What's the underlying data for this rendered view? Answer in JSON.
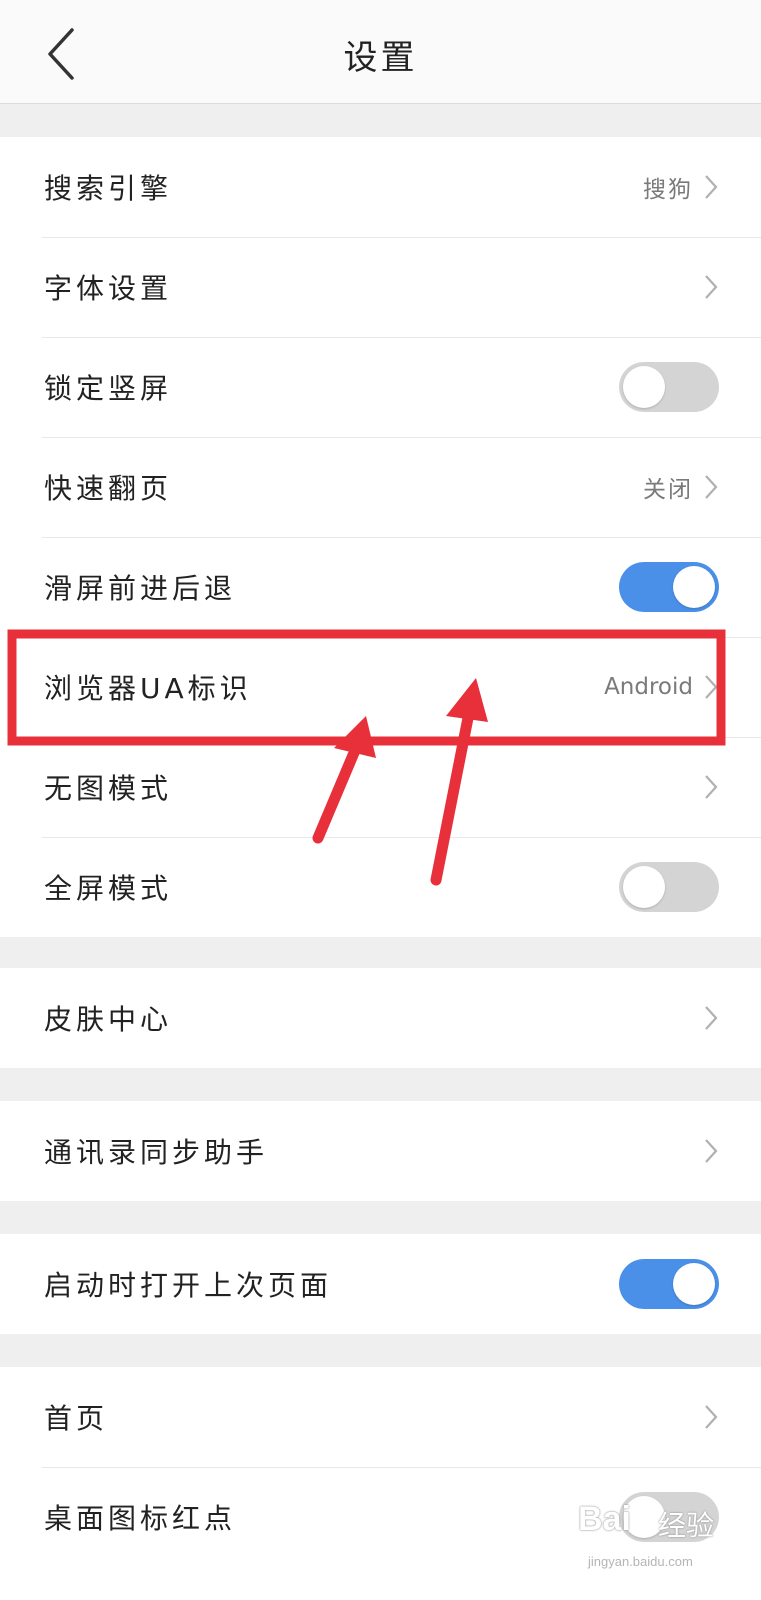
{
  "header": {
    "title": "设置"
  },
  "groups": [
    {
      "rows": [
        {
          "label": "搜索引擎",
          "value": "搜狗"
        },
        {
          "label": "字体设置"
        },
        {
          "label": "锁定竖屏",
          "toggle": false
        },
        {
          "label": "快速翻页",
          "value": "关闭"
        },
        {
          "label": "滑屏前进后退",
          "toggle": true
        },
        {
          "label": "浏览器UA标识",
          "value": "Android"
        },
        {
          "label": "无图模式"
        },
        {
          "label": "全屏模式",
          "toggle": false
        }
      ]
    },
    {
      "rows": [
        {
          "label": "皮肤中心"
        }
      ]
    },
    {
      "rows": [
        {
          "label": "通讯录同步助手"
        }
      ]
    },
    {
      "rows": [
        {
          "label": "启动时打开上次页面",
          "toggle": true
        }
      ]
    },
    {
      "rows": [
        {
          "label": "首页"
        },
        {
          "label": "桌面图标红点",
          "toggle": false
        }
      ]
    }
  ],
  "colors": {
    "toggle_on": "#4a90e8",
    "toggle_off": "#d4d4d4",
    "annotation": "#e8303a"
  },
  "watermark": {
    "logo": "Bai",
    "text": "经验",
    "url": "jingyan.baidu.com"
  }
}
